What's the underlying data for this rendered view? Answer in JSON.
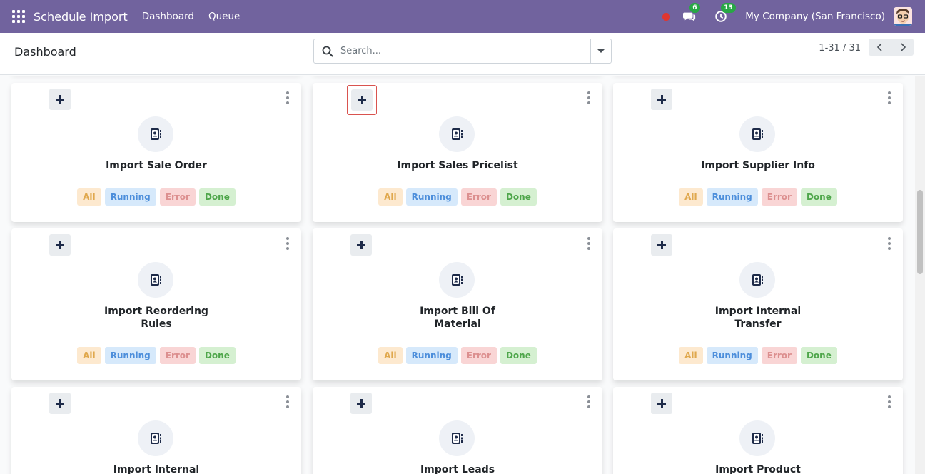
{
  "navbar": {
    "app_title": "Schedule Import",
    "menu": [
      "Dashboard",
      "Queue"
    ],
    "messages_count": "6",
    "activities_count": "13",
    "company": "My Company (San Francisco)",
    "accent_color": "#71639e"
  },
  "control": {
    "title": "Dashboard",
    "search_placeholder": "Search...",
    "pager": "1-31 / 31"
  },
  "cards": [
    {
      "title_lines": [
        "Import Sale Order"
      ],
      "states": [
        "All",
        "Running",
        "Error",
        "Done"
      ]
    },
    {
      "title_lines": [
        "Import Sales Pricelist"
      ],
      "states": [
        "All",
        "Running",
        "Error",
        "Done"
      ]
    },
    {
      "title_lines": [
        "Import Supplier Info"
      ],
      "states": [
        "All",
        "Running",
        "Error",
        "Done"
      ]
    },
    {
      "title_lines": [
        "Import Reordering",
        "Rules"
      ],
      "states": [
        "All",
        "Running",
        "Error",
        "Done"
      ]
    },
    {
      "title_lines": [
        "Import Bill Of",
        "Material"
      ],
      "states": [
        "All",
        "Running",
        "Error",
        "Done"
      ]
    },
    {
      "title_lines": [
        "Import Internal",
        "Transfer"
      ],
      "states": [
        "All",
        "Running",
        "Error",
        "Done"
      ]
    },
    {
      "title_lines": [
        "Import Internal"
      ],
      "states": []
    },
    {
      "title_lines": [
        "Import Leads"
      ],
      "states": []
    },
    {
      "title_lines": [
        "Import Product"
      ],
      "states": []
    }
  ],
  "icons": {
    "apps": "apps-grid-icon",
    "messages": "chat-bubbles-icon",
    "activities": "clock-icon",
    "search": "search-icon",
    "card": "address-book-icon",
    "add": "plus-icon",
    "menu": "kebab-icon"
  }
}
